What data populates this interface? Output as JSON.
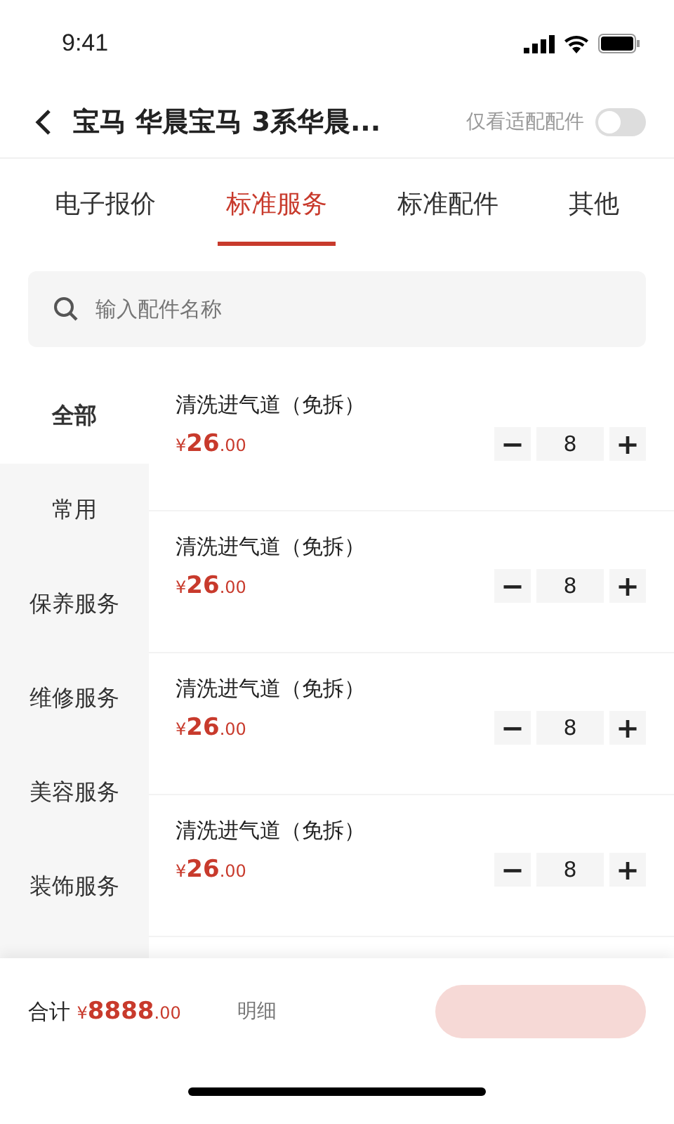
{
  "status_bar": {
    "time": "9:41"
  },
  "header": {
    "title": "宝马 华晨宝马 3系华晨...",
    "filter_label": "仅看适配配件",
    "filter_on": false
  },
  "tabs": [
    {
      "label": "电子报价",
      "selected": false
    },
    {
      "label": "标准服务",
      "selected": true
    },
    {
      "label": "标准配件",
      "selected": false
    },
    {
      "label": "其他",
      "selected": false
    }
  ],
  "search": {
    "placeholder": "输入配件名称"
  },
  "categories": [
    {
      "label": "全部",
      "selected": true
    },
    {
      "label": "常用",
      "selected": false
    },
    {
      "label": "保养服务",
      "selected": false
    },
    {
      "label": "维修服务",
      "selected": false
    },
    {
      "label": "美容服务",
      "selected": false
    },
    {
      "label": "装饰服务",
      "selected": false
    }
  ],
  "items": [
    {
      "name": "清洗进气道（免拆）",
      "price_symbol": "¥",
      "price_int": "26",
      "price_dec": ".00",
      "minus": "−",
      "quantity": "8",
      "plus": "+"
    },
    {
      "name": "清洗进气道（免拆）",
      "price_symbol": "¥",
      "price_int": "26",
      "price_dec": ".00",
      "minus": "−",
      "quantity": "8",
      "plus": "+"
    },
    {
      "name": "清洗进气道（免拆）",
      "price_symbol": "¥",
      "price_int": "26",
      "price_dec": ".00",
      "minus": "−",
      "quantity": "8",
      "plus": "+"
    },
    {
      "name": "清洗进气道（免拆）",
      "price_symbol": "¥",
      "price_int": "26",
      "price_dec": ".00",
      "minus": "−",
      "quantity": "8",
      "plus": "+"
    }
  ],
  "footer": {
    "total_label": "合计",
    "total_symbol": "¥",
    "total_int": "8888",
    "total_dec": ".00",
    "detail_label": "明细"
  }
}
